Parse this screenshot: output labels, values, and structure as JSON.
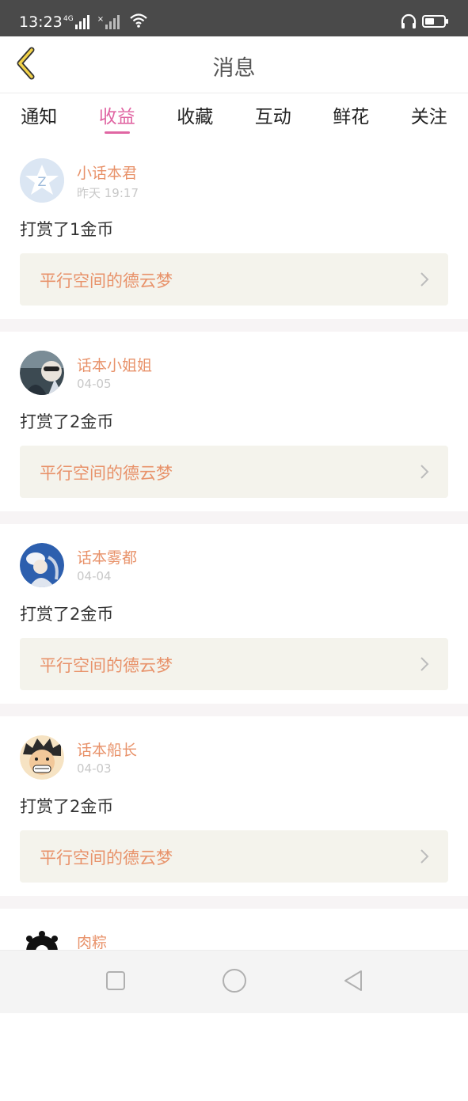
{
  "status_bar": {
    "time": "13:23",
    "network_label": "4G",
    "icons": [
      "signal-icon",
      "no-signal-icon",
      "wifi-icon",
      "headset-icon",
      "battery-icon"
    ]
  },
  "header": {
    "title": "消息",
    "back_icon": "chevron-left-icon"
  },
  "tabs": [
    {
      "label": "通知",
      "active": false
    },
    {
      "label": "收益",
      "active": true
    },
    {
      "label": "收藏",
      "active": false
    },
    {
      "label": "互动",
      "active": false
    },
    {
      "label": "鲜花",
      "active": false
    },
    {
      "label": "关注",
      "active": false
    }
  ],
  "messages": [
    {
      "sender": "小话本君",
      "time": "昨天 19:17",
      "text": "打赏了1金币",
      "story": "平行空间的德云梦"
    },
    {
      "sender": "话本小姐姐",
      "time": "04-05",
      "text": "打赏了2金币",
      "story": "平行空间的德云梦"
    },
    {
      "sender": "话本雾都",
      "time": "04-04",
      "text": "打赏了2金币",
      "story": "平行空间的德云梦"
    },
    {
      "sender": "话本船长",
      "time": "04-03",
      "text": "打赏了2金币",
      "story": "平行空间的德云梦"
    },
    {
      "sender": "肉粽",
      "time": "",
      "text": "",
      "story": ""
    }
  ],
  "colors": {
    "accent_pink": "#e066a3",
    "name_orange": "#e8926a",
    "link_bg": "#f4f3ec",
    "status_bar_bg": "#4a4a4a"
  },
  "nav": {
    "icons": [
      "recents-square-icon",
      "home-circle-icon",
      "back-triangle-icon"
    ]
  }
}
